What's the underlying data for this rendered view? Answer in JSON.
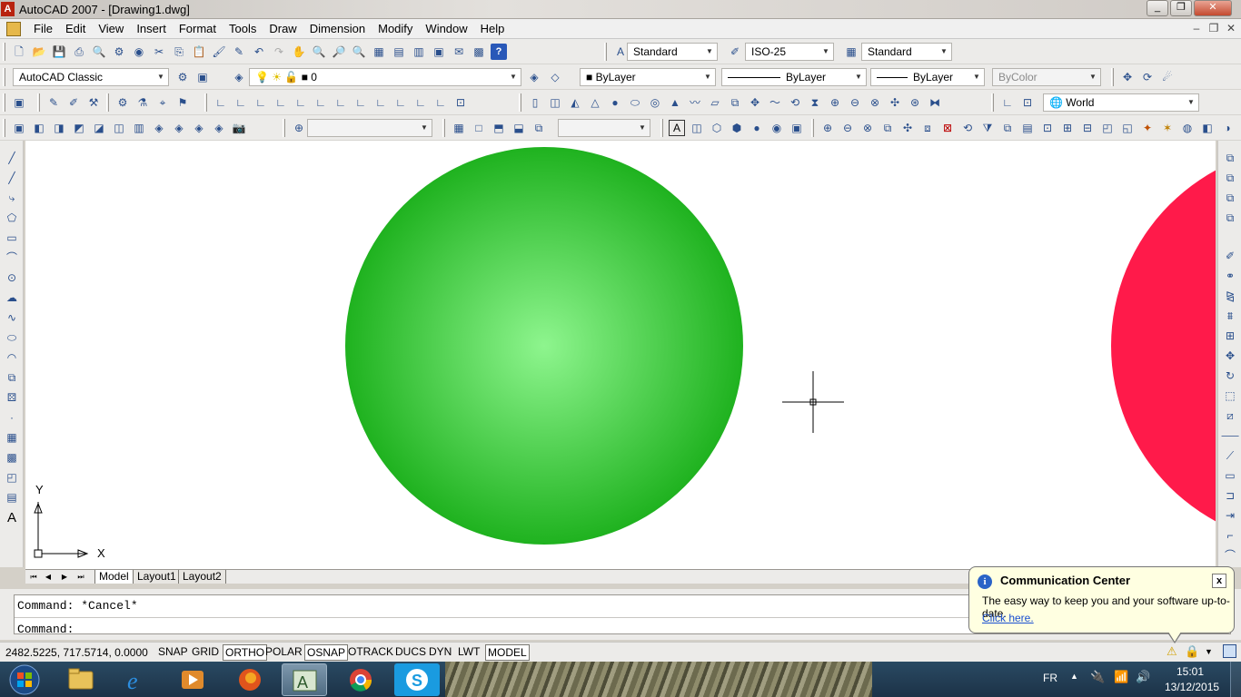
{
  "window": {
    "title": "AutoCAD 2007 - [Drawing1.dwg]",
    "app_icon_letter": "A",
    "minimize": "_",
    "maximize": "❐",
    "close": "✕"
  },
  "menubar": {
    "items": [
      "File",
      "Edit",
      "View",
      "Insert",
      "Format",
      "Tools",
      "Draw",
      "Dimension",
      "Modify",
      "Window",
      "Help"
    ],
    "mdi_minimize": "–",
    "mdi_restore": "❐",
    "mdi_close": "✕"
  },
  "styles_toolbar": {
    "text_style": "Standard",
    "dim_style": "ISO-25",
    "table_style": "Standard"
  },
  "workspace": {
    "name": "AutoCAD Classic"
  },
  "layers": {
    "current_layer": "0"
  },
  "properties": {
    "color": "ByLayer",
    "linetype": "ByLayer",
    "lineweight": "ByLayer",
    "plot_style": "ByColor"
  },
  "ucs": {
    "current": "World"
  },
  "canvas": {
    "ucs_icon_x": "X",
    "ucs_icon_y": "Y",
    "shapes": [
      {
        "name": "green-sphere",
        "color": "#1fb21f",
        "highlight": "#8ef58e"
      },
      {
        "name": "red-sphere",
        "color": "#ff1a4a",
        "highlight": "#ff3c66"
      }
    ]
  },
  "layout_tabs": {
    "tabs": [
      "Model",
      "Layout1",
      "Layout2"
    ],
    "active": "Model"
  },
  "command_line": {
    "history": "Command: *Cancel*",
    "prompt": "Command:"
  },
  "status_bar": {
    "coordinates": "2482.5225, 717.5714, 0.0000",
    "toggles": [
      {
        "label": "SNAP",
        "on": false
      },
      {
        "label": "GRID",
        "on": false
      },
      {
        "label": "ORTHO",
        "on": true
      },
      {
        "label": "POLAR",
        "on": false
      },
      {
        "label": "OSNAP",
        "on": true
      },
      {
        "label": "OTRACK",
        "on": false
      },
      {
        "label": "DUCS",
        "on": false
      },
      {
        "label": "DYN",
        "on": false
      },
      {
        "label": "LWT",
        "on": false
      },
      {
        "label": "MODEL",
        "on": true
      }
    ]
  },
  "communication_center": {
    "title": "Communication Center",
    "message": "The easy way to keep you and your software up-to-date.",
    "link": "Click here.",
    "close": "x"
  },
  "taskbar": {
    "apps": [
      "windows-explorer",
      "internet-explorer",
      "media-player",
      "firefox",
      "autocad",
      "chrome",
      "skype"
    ],
    "active_app": "autocad",
    "language": "FR",
    "time": "15:01",
    "date": "13/12/2015"
  }
}
